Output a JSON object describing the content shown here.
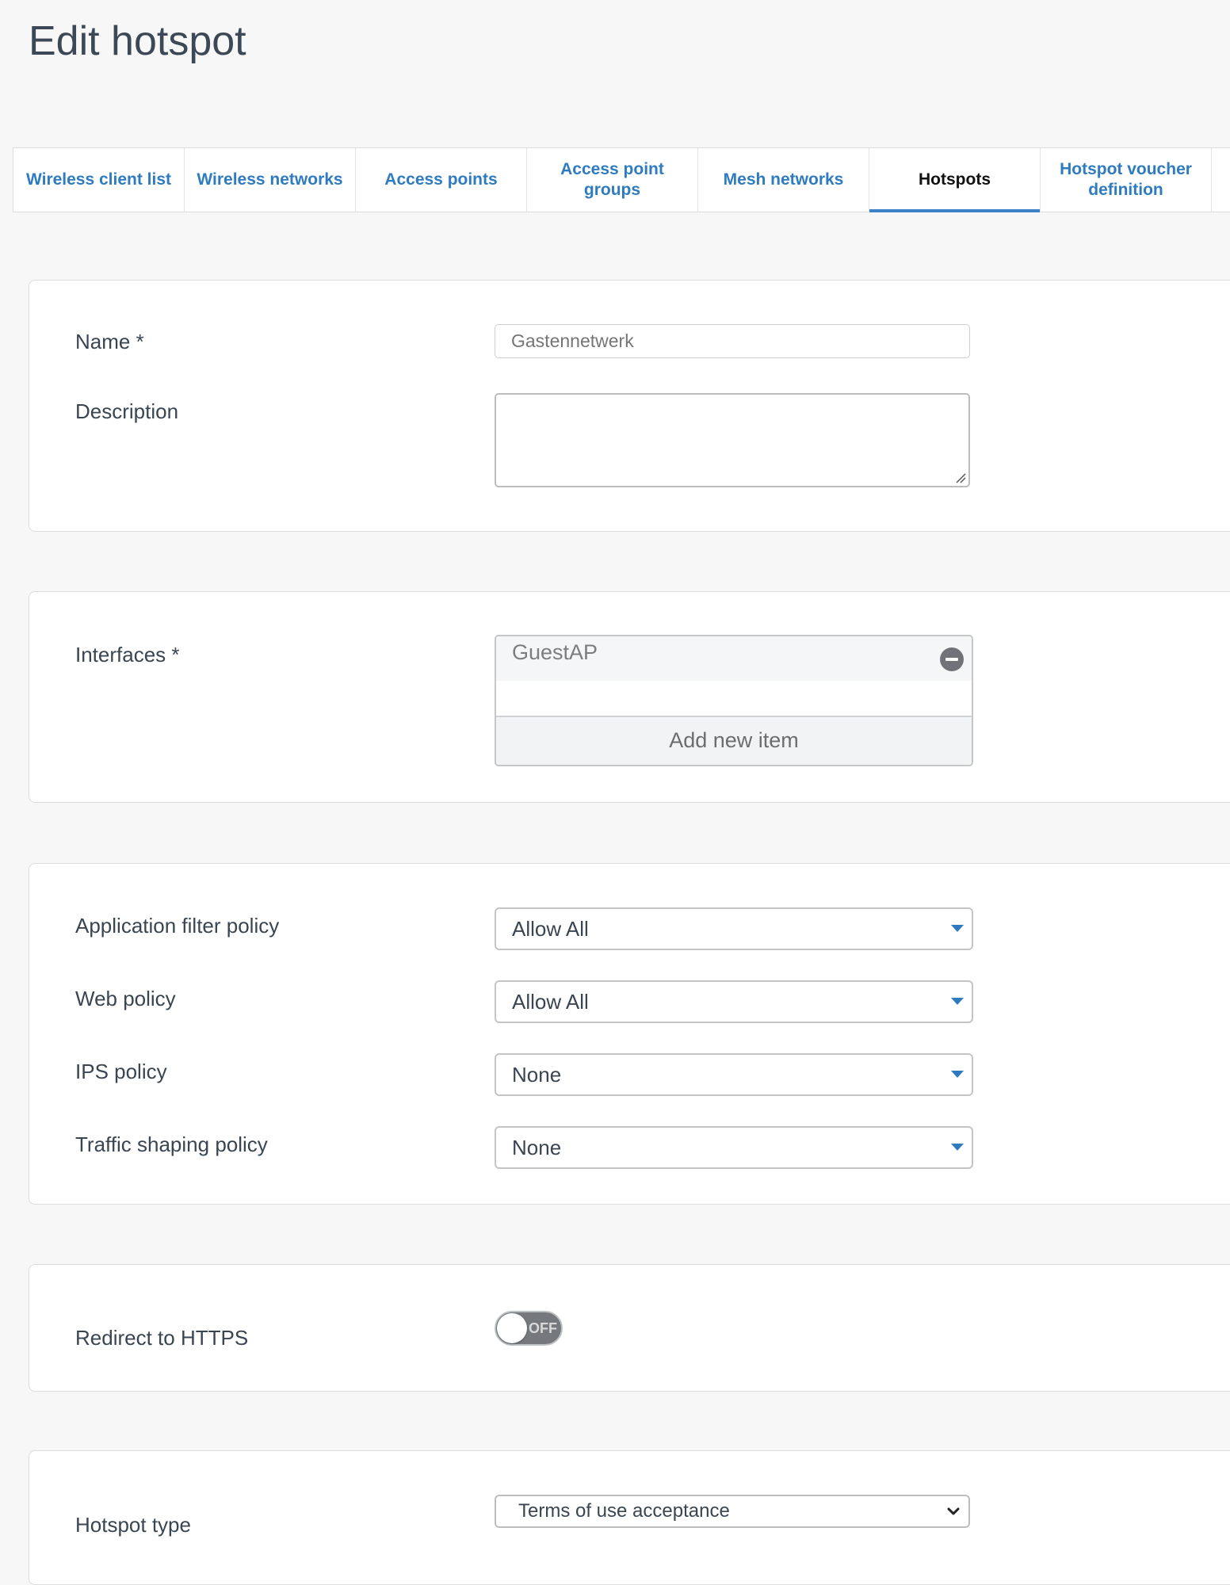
{
  "page": {
    "title": "Edit hotspot"
  },
  "tabs": [
    {
      "label": "Wireless client list",
      "active": false
    },
    {
      "label": "Wireless networks",
      "active": false
    },
    {
      "label": "Access points",
      "active": false
    },
    {
      "label": "Access point groups",
      "active": false
    },
    {
      "label": "Mesh networks",
      "active": false
    },
    {
      "label": "Hotspots",
      "active": true
    },
    {
      "label": "Hotspot voucher definition",
      "active": false
    }
  ],
  "general": {
    "name_label": "Name *",
    "name_placeholder": "Gastennetwerk",
    "name_value": "",
    "description_label": "Description",
    "description_value": ""
  },
  "interfaces": {
    "label": "Interfaces *",
    "items": [
      "GuestAP"
    ],
    "add_label": "Add new item"
  },
  "policies": {
    "app_filter_label": "Application filter policy",
    "app_filter_value": "Allow All",
    "web_label": "Web policy",
    "web_value": "Allow All",
    "ips_label": "IPS policy",
    "ips_value": "None",
    "traffic_label": "Traffic shaping policy",
    "traffic_value": "None"
  },
  "https": {
    "label": "Redirect to HTTPS",
    "toggle_text": "OFF",
    "enabled": false
  },
  "hotspot_type": {
    "label": "Hotspot type",
    "value": "Terms of use acceptance"
  },
  "colors": {
    "accent": "#2f7bc0",
    "active_underline": "#3b82c8",
    "toggle_off": "#75797e"
  }
}
